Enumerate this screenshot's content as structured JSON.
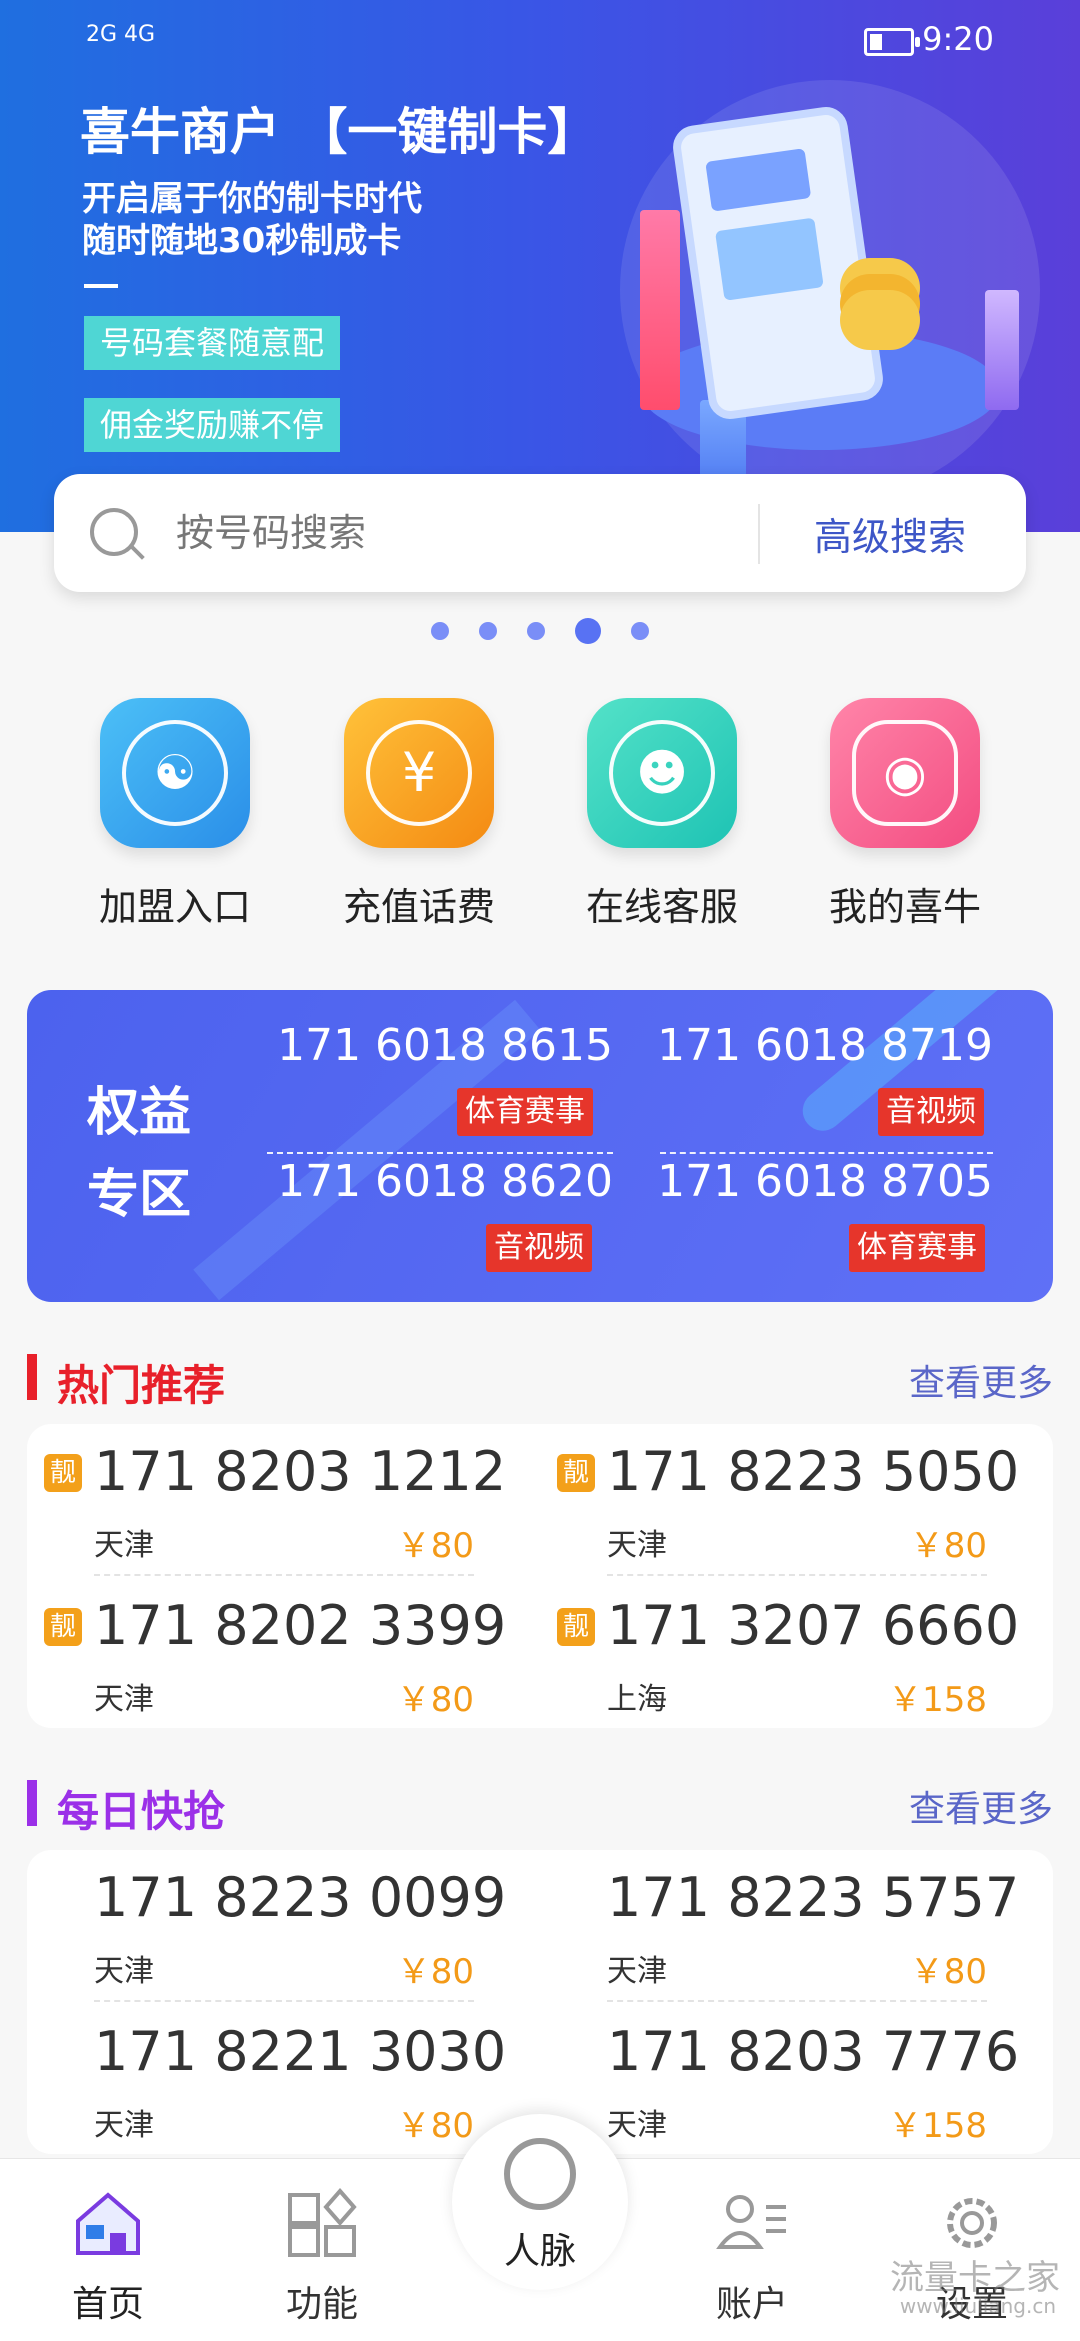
{
  "status_bar": {
    "signal": "2G 4G",
    "time": "9:20"
  },
  "banner": {
    "title": "喜牛商户 【一键制卡】",
    "subtitle_line1": "开启属于你的制卡时代",
    "subtitle_line2": "随时随地30秒制成卡",
    "tag1": "号码套餐随意配",
    "tag2": "佣金奖励赚不停"
  },
  "search": {
    "placeholder": "按号码搜索",
    "advanced": "高级搜索"
  },
  "carousel": {
    "count": 5,
    "active_index": 3
  },
  "quick_actions": [
    {
      "label": "加盟入口",
      "icon": "users-icon",
      "color": "#33a8f0"
    },
    {
      "label": "充值话费",
      "icon": "yuan-coin-icon",
      "color": "#f7a21c"
    },
    {
      "label": "在线客服",
      "icon": "headset-icon",
      "color": "#2fd2bf"
    },
    {
      "label": "我的喜牛",
      "icon": "cow-icon",
      "color": "#fb5a8a"
    }
  ],
  "equity": {
    "title_line1": "权益",
    "title_line2": "专区",
    "items": [
      {
        "number": "171 6018 8615",
        "tag": "体育赛事"
      },
      {
        "number": "171 6018 8719",
        "tag": "音视频"
      },
      {
        "number": "171 6018 8620",
        "tag": "音视频"
      },
      {
        "number": "171 6018 8705",
        "tag": "体育赛事"
      }
    ]
  },
  "hot": {
    "title": "热门推荐",
    "more": "查看更多",
    "badge": "靓",
    "accent": "#e8202a",
    "items": [
      {
        "number": "171 8203 1212",
        "city": "天津",
        "price": "￥80"
      },
      {
        "number": "171 8223 5050",
        "city": "天津",
        "price": "￥80"
      },
      {
        "number": "171 8202 3399",
        "city": "天津",
        "price": "￥80"
      },
      {
        "number": "171 3207 6660",
        "city": "上海",
        "price": "￥158"
      }
    ]
  },
  "daily": {
    "title": "每日快抢",
    "more": "查看更多",
    "accent": "#9b30e8",
    "items": [
      {
        "number": "171 8223 0099",
        "city": "天津",
        "price": "￥80"
      },
      {
        "number": "171 8223 5757",
        "city": "天津",
        "price": "￥80"
      },
      {
        "number": "171 8221 3030",
        "city": "天津",
        "price": "￥80"
      },
      {
        "number": "171 8203 7776",
        "city": "天津",
        "price": "￥158"
      }
    ]
  },
  "tabbar": {
    "home": "首页",
    "features": "功能",
    "center": "人脉",
    "account": "账户",
    "settings": "设置"
  },
  "watermark": {
    "line1": "流量卡之家",
    "line2": "www.liuliang.cn"
  }
}
